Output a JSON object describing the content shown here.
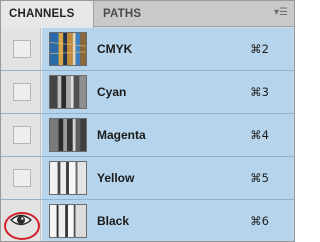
{
  "panel": {
    "tabs": [
      {
        "label": "CHANNELS",
        "active": true
      },
      {
        "label": "PATHS",
        "active": false
      }
    ],
    "menu_icon": "panel-menu-icon"
  },
  "channels": [
    {
      "name": "CMYK",
      "shortcut": "⌘2",
      "visible": false,
      "thumb": "color"
    },
    {
      "name": "Cyan",
      "shortcut": "⌘3",
      "visible": false,
      "thumb": "gray"
    },
    {
      "name": "Magenta",
      "shortcut": "⌘4",
      "visible": false,
      "thumb": "gray"
    },
    {
      "name": "Yellow",
      "shortcut": "⌘5",
      "visible": false,
      "thumb": "light"
    },
    {
      "name": "Black",
      "shortcut": "⌘6",
      "visible": true,
      "thumb": "light"
    }
  ],
  "colors": {
    "selection": "#b6d5ec",
    "highlight_ring": "#d21f2a"
  }
}
